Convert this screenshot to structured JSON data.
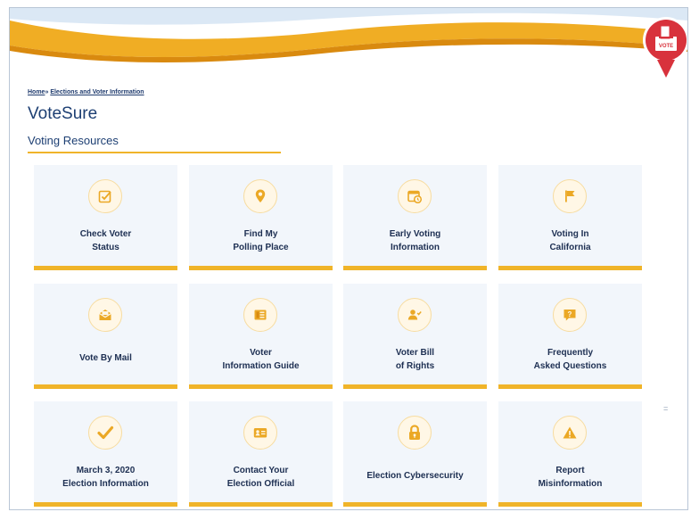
{
  "badge": {
    "text": "VOTE"
  },
  "breadcrumb": {
    "home": "Home",
    "separator": "»",
    "current": "Elections and Voter Information"
  },
  "page": {
    "title": "VoteSure",
    "section": "Voting Resources"
  },
  "tiles": [
    {
      "label": "Check Voter\nStatus",
      "icon": "checkbox-icon"
    },
    {
      "label": "Find My\nPolling Place",
      "icon": "location-pin-icon"
    },
    {
      "label": "Early Voting\nInformation",
      "icon": "calendar-clock-icon"
    },
    {
      "label": "Voting In\nCalifornia",
      "icon": "flag-icon"
    },
    {
      "label": "Vote By Mail",
      "icon": "envelope-icon"
    },
    {
      "label": "Voter\nInformation Guide",
      "icon": "guide-book-icon"
    },
    {
      "label": "Voter Bill\nof Rights",
      "icon": "voter-person-icon"
    },
    {
      "label": "Frequently\nAsked Questions",
      "icon": "question-icon"
    },
    {
      "label": "March 3, 2020\nElection Information",
      "icon": "checkmark-icon"
    },
    {
      "label": "Contact Your\nElection Official",
      "icon": "id-card-icon"
    },
    {
      "label": "Election Cybersecurity",
      "icon": "lock-icon"
    },
    {
      "label": "Report\nMisinformation",
      "icon": "warning-icon"
    }
  ],
  "colors": {
    "accent": "#f0b429",
    "heading": "#1d3f73",
    "tile_bg": "#f2f6fb",
    "badge_red": "#d8323c"
  },
  "scroll_indicator": "="
}
